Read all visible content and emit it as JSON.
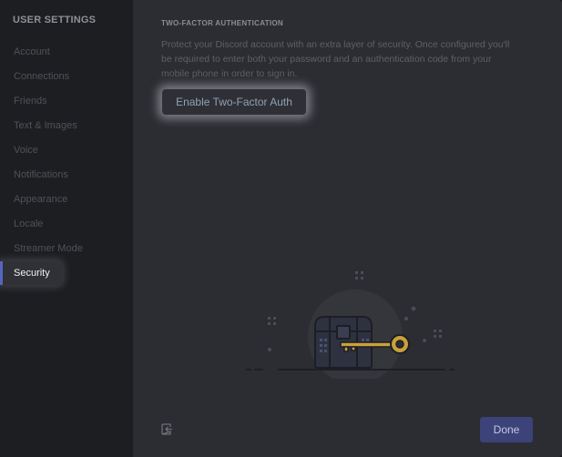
{
  "sidebar": {
    "title": "USER SETTINGS",
    "items": [
      {
        "label": "Account"
      },
      {
        "label": "Connections"
      },
      {
        "label": "Friends"
      },
      {
        "label": "Text & Images"
      },
      {
        "label": "Voice"
      },
      {
        "label": "Notifications"
      },
      {
        "label": "Appearance"
      },
      {
        "label": "Locale"
      },
      {
        "label": "Streamer Mode"
      },
      {
        "label": "Security",
        "active": true
      }
    ]
  },
  "main": {
    "section_title": "TWO-FACTOR AUTHENTICATION",
    "description": "Protect your Discord account with an extra layer of security. Once configured you'll be required to enter both your password and an authentication code from your mobile phone in order to sign in.",
    "enable_button_label": "Enable Two-Factor Auth",
    "illustration_icon": "treasure-chest-key-illustration"
  },
  "footer": {
    "back_icon": "exit-arrow-icon",
    "done_label": "Done"
  },
  "colors": {
    "accent": "#5865c0",
    "done_button": "#3b4378",
    "key": "#c9a13a"
  }
}
